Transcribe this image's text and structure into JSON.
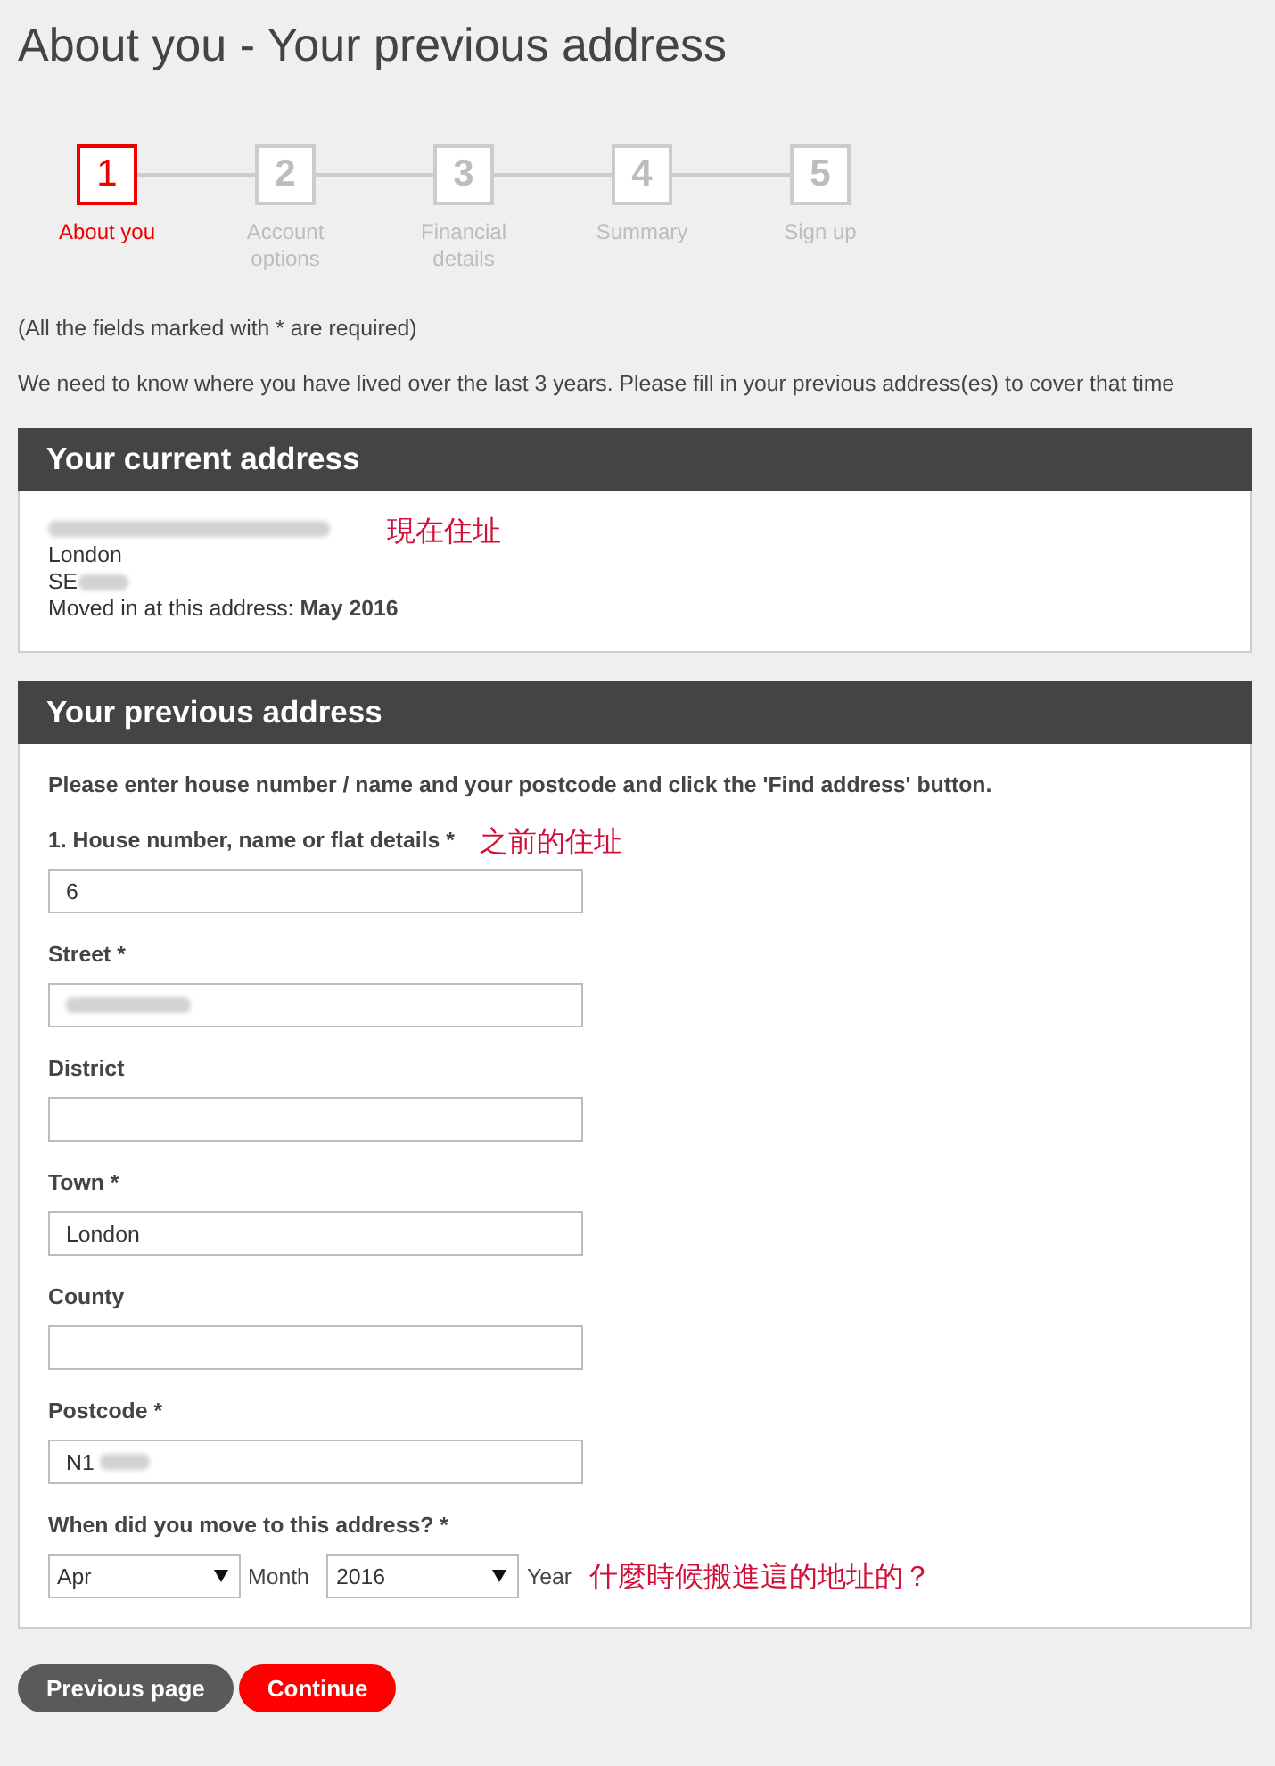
{
  "page": {
    "title": "About you - Your previous address"
  },
  "steps": [
    {
      "number": "1",
      "label": "About you",
      "selected": true
    },
    {
      "number": "2",
      "label": "Account options",
      "selected": false
    },
    {
      "number": "3",
      "label": "Financial details",
      "selected": false
    },
    {
      "number": "4",
      "label": "Summary",
      "selected": false
    },
    {
      "number": "5",
      "label": "Sign up",
      "selected": false
    }
  ],
  "required_note": "(All the fields marked with * are required)",
  "intro": "We need to know where you have lived over the last 3 years. Please fill in your previous address(es) to cover that time",
  "current_address": {
    "title": "Your current address",
    "annotation": "現在住址",
    "lines": [
      {
        "blurred": true
      },
      {
        "text": "London",
        "blurred": false
      },
      {
        "text": "SE",
        "blurred": true
      }
    ],
    "moved_in": "Moved in at this address: **May 2016**"
  },
  "previous_address": {
    "title": "Your previous address",
    "instruction": "Please enter house number / name and your postcode and click the 'Find address' button.",
    "fields": [
      {
        "label": "1. House number, name or flat details *",
        "value": "6",
        "blurred": false,
        "annotation": "之前的住址"
      },
      {
        "label": "Street *",
        "blurred": true
      },
      {
        "label": "District",
        "blurred": false
      },
      {
        "label": "Town *",
        "value": "London",
        "blurred": false
      },
      {
        "label": "County",
        "blurred": false
      },
      {
        "label": "Postcode *",
        "value": "N1",
        "blurred": true
      }
    ],
    "move_date": {
      "label": "When did you move to this address? *",
      "month": {
        "value": "Apr",
        "unit": "Month"
      },
      "year": {
        "value": "2016",
        "unit": "Year"
      },
      "annotation": "什麼時候搬進這的地址的？"
    }
  },
  "buttons": [
    {
      "label": "Previous page",
      "kind": "secondary"
    },
    {
      "label": "Continue",
      "kind": "primary"
    }
  ]
}
